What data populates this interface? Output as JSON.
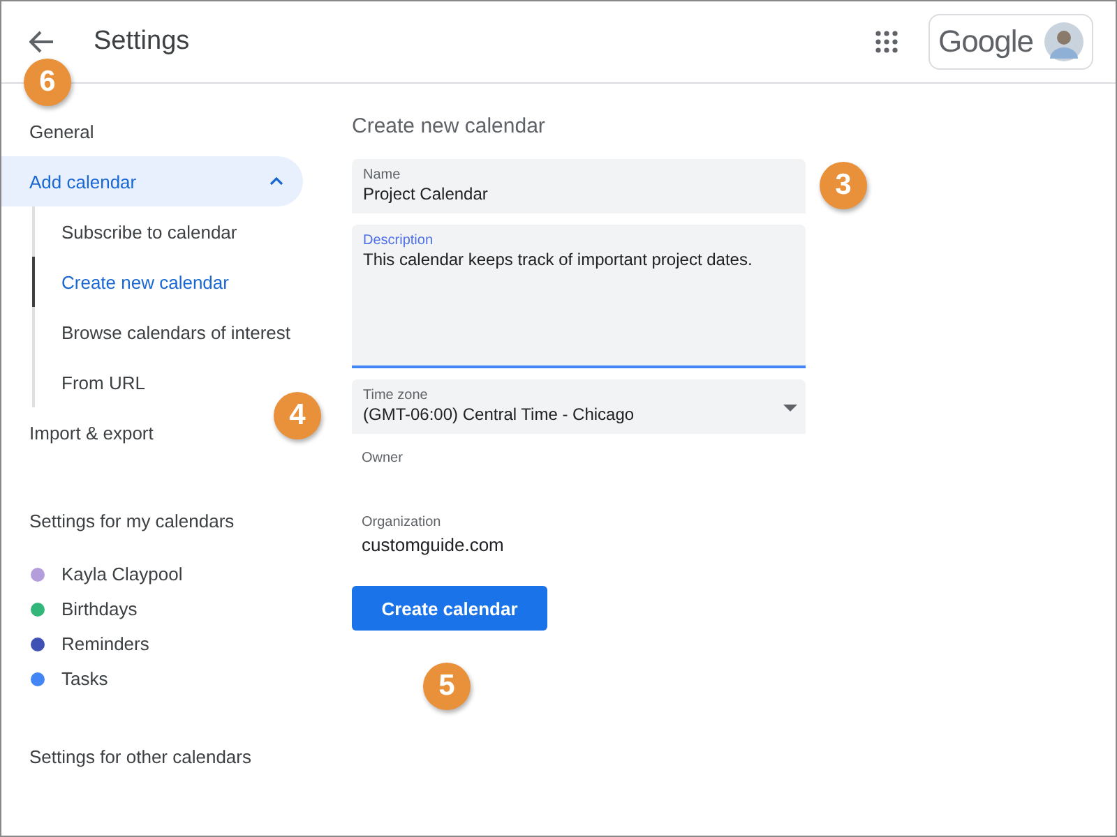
{
  "header": {
    "title": "Settings",
    "logo": "Google"
  },
  "sidebar": {
    "items": [
      {
        "label": "General",
        "selected": false
      },
      {
        "label": "Add calendar",
        "selected": true,
        "expanded": true,
        "children": [
          {
            "label": "Subscribe to calendar",
            "selected": false
          },
          {
            "label": "Create new calendar",
            "selected": true
          },
          {
            "label": "Browse calendars of interest",
            "selected": false
          },
          {
            "label": "From URL",
            "selected": false
          }
        ]
      },
      {
        "label": "Import & export",
        "selected": false
      }
    ],
    "my_calendars": {
      "heading": "Settings for my calendars",
      "items": [
        {
          "label": "Kayla Claypool",
          "color": "#b39ddb"
        },
        {
          "label": "Birthdays",
          "color": "#33b679"
        },
        {
          "label": "Reminders",
          "color": "#3f51b5"
        },
        {
          "label": "Tasks",
          "color": "#4285f4"
        }
      ]
    },
    "other_calendars": {
      "heading": "Settings for other calendars"
    }
  },
  "form": {
    "title": "Create new calendar",
    "fields": [
      {
        "kind": "text",
        "label": "Name",
        "value": "Project Calendar",
        "focused": false
      },
      {
        "kind": "textarea",
        "label": "Description",
        "value": "This calendar keeps track of important project dates.",
        "focused": true
      },
      {
        "kind": "select",
        "label": "Time zone",
        "value": "(GMT-06:00) Central Time - Chicago",
        "focused": false
      },
      {
        "kind": "info",
        "label": "Owner"
      },
      {
        "kind": "info",
        "label": "Organization",
        "value": "customguide.com"
      }
    ],
    "button": "Create calendar"
  },
  "callouts": [
    {
      "number": "6"
    },
    {
      "number": "3"
    },
    {
      "number": "4"
    },
    {
      "number": "5"
    }
  ]
}
